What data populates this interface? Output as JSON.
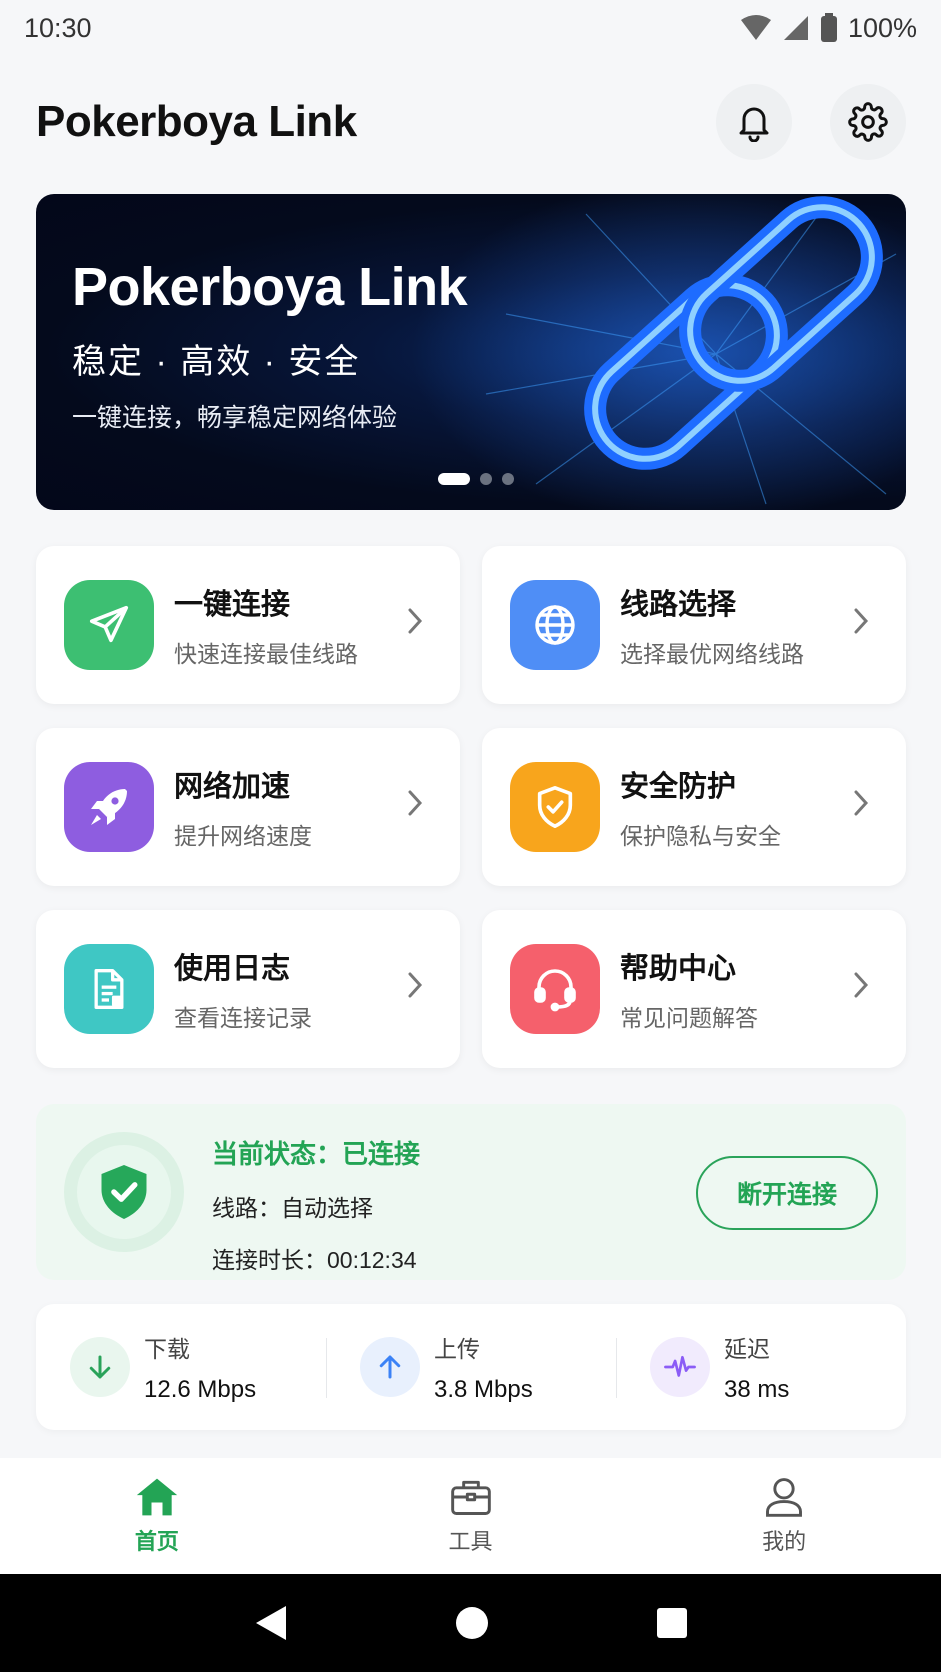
{
  "status_bar": {
    "time": "10:30",
    "battery": "100%"
  },
  "header": {
    "title": "Pokerboya Link",
    "bell_icon": "bell-icon",
    "settings_icon": "gear-icon"
  },
  "banner": {
    "title": "Pokerboya Link",
    "subtitle": "稳定 · 高效 · 安全",
    "description": "一键连接，畅享稳定网络体验",
    "active_dot": 1,
    "dot_count": 3
  },
  "features": [
    {
      "title": "一键连接",
      "subtitle": "快速连接最佳线路",
      "icon": "paper-plane-icon",
      "color": "#3dbf72"
    },
    {
      "title": "线路选择",
      "subtitle": "选择最优网络线路",
      "icon": "globe-icon",
      "color": "#4f8ef6"
    },
    {
      "title": "网络加速",
      "subtitle": "提升网络速度",
      "icon": "rocket-icon",
      "color": "#8e5de0"
    },
    {
      "title": "安全防护",
      "subtitle": "保护隐私与安全",
      "icon": "shield-icon",
      "color": "#f8a51c"
    },
    {
      "title": "使用日志",
      "subtitle": "查看连接记录",
      "icon": "document-icon",
      "color": "#3fc7c4"
    },
    {
      "title": "帮助中心",
      "subtitle": "常见问题解答",
      "icon": "headset-icon",
      "color": "#f5606c"
    }
  ],
  "connection": {
    "status": "当前状态：已连接",
    "route": "线路：自动选择",
    "duration": "连接时长：00:12:34",
    "disconnect_label": "断开连接",
    "accent": "#23a455"
  },
  "stats": [
    {
      "label": "下载",
      "value": "12.6 Mbps",
      "icon": "arrow-down-icon",
      "color": "#2aa35a"
    },
    {
      "label": "上传",
      "value": "3.8 Mbps",
      "icon": "arrow-up-icon",
      "color": "#3b82f6"
    },
    {
      "label": "延迟",
      "value": "38 ms",
      "icon": "pulse-icon",
      "color": "#8b5cf6"
    }
  ],
  "tabs": [
    {
      "label": "首页",
      "icon": "home-icon",
      "active": true
    },
    {
      "label": "工具",
      "icon": "toolbox-icon",
      "active": false
    },
    {
      "label": "我的",
      "icon": "user-icon",
      "active": false
    }
  ]
}
